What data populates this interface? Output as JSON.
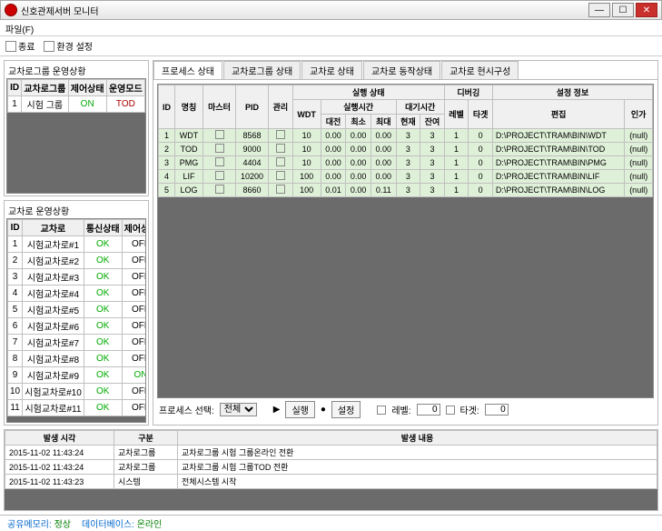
{
  "window": {
    "title": "신호관제서버 모니터"
  },
  "menu": {
    "file": "파일(F)"
  },
  "toolbar": {
    "exit": "종료",
    "env": "환경 설정"
  },
  "left": {
    "group1_title": "교차로그룹 운영상황",
    "g1_headers": [
      "ID",
      "교차로그룹",
      "제어상태",
      "운영모드"
    ],
    "g1_rows": [
      [
        "1",
        "시험 그룹",
        "ON",
        "TOD"
      ]
    ],
    "group2_title": "교차로 운영상황",
    "g2_headers": [
      "ID",
      "교차로",
      "통신상태",
      "제어상태"
    ],
    "g2_rows": [
      [
        "1",
        "시험교차로#1",
        "OK",
        "OFF"
      ],
      [
        "2",
        "시험교차로#2",
        "OK",
        "OFF"
      ],
      [
        "3",
        "시험교차로#3",
        "OK",
        "OFF"
      ],
      [
        "4",
        "시험교차로#4",
        "OK",
        "OFF"
      ],
      [
        "5",
        "시험교차로#5",
        "OK",
        "OFF"
      ],
      [
        "6",
        "시험교차로#6",
        "OK",
        "OFF"
      ],
      [
        "7",
        "시험교차로#7",
        "OK",
        "OFF"
      ],
      [
        "8",
        "시험교차로#8",
        "OK",
        "OFF"
      ],
      [
        "9",
        "시험교차로#9",
        "OK",
        "ON"
      ],
      [
        "10",
        "시험교차로#10",
        "OK",
        "OFF"
      ],
      [
        "11",
        "시험교차로#11",
        "OK",
        "OFF"
      ]
    ]
  },
  "tabs": {
    "t1": "프로세스 상태",
    "t2": "교차로그룹 상태",
    "t3": "교차로 상태",
    "t4": "교차로 동작상태",
    "t5": "교차로 현시구성"
  },
  "proc": {
    "group_top": [
      "실행 상태",
      "디버깅",
      "설정 정보"
    ],
    "group_mid": [
      "실행시간",
      "대기시간"
    ],
    "headers": [
      "ID",
      "명칭",
      "마스터",
      "PID",
      "관리",
      "WDT",
      "대전",
      "최소",
      "최대",
      "현재",
      "잔여",
      "레벨",
      "타겟",
      "편집",
      "인가"
    ],
    "rows": [
      {
        "id": "1",
        "name": "WDT",
        "pid": "8568",
        "wdt": "10",
        "a": "0.00",
        "b": "0.00",
        "c": "0.00",
        "d": "3",
        "e": "3",
        "lv": "1",
        "tg": "0",
        "path": "D:\\PROJECT\\TRAM\\BIN\\WDT",
        "auth": "(null)"
      },
      {
        "id": "2",
        "name": "TOD",
        "pid": "9000",
        "wdt": "10",
        "a": "0.00",
        "b": "0.00",
        "c": "0.00",
        "d": "3",
        "e": "3",
        "lv": "1",
        "tg": "0",
        "path": "D:\\PROJECT\\TRAM\\BIN\\TOD",
        "auth": "(null)"
      },
      {
        "id": "3",
        "name": "PMG",
        "pid": "4404",
        "wdt": "10",
        "a": "0.00",
        "b": "0.00",
        "c": "0.00",
        "d": "3",
        "e": "3",
        "lv": "1",
        "tg": "0",
        "path": "D:\\PROJECT\\TRAM\\BIN\\PMG",
        "auth": "(null)"
      },
      {
        "id": "4",
        "name": "LIF",
        "pid": "10200",
        "wdt": "100",
        "a": "0.00",
        "b": "0.00",
        "c": "0.00",
        "d": "3",
        "e": "3",
        "lv": "1",
        "tg": "0",
        "path": "D:\\PROJECT\\TRAM\\BIN\\LIF",
        "auth": "(null)"
      },
      {
        "id": "5",
        "name": "LOG",
        "pid": "8660",
        "wdt": "100",
        "a": "0.01",
        "b": "0.00",
        "c": "0.11",
        "d": "3",
        "e": "3",
        "lv": "1",
        "tg": "0",
        "path": "D:\\PROJECT\\TRAM\\BIN\\LOG",
        "auth": "(null)"
      }
    ]
  },
  "controls": {
    "select_label": "프로세스 선택:",
    "select_value": "전체",
    "play": "실행",
    "stop": "설정",
    "level_label": "레벨:",
    "level_value": "0",
    "target_label": "타겟:",
    "target_value": "0"
  },
  "logs": {
    "headers": [
      "발생 시각",
      "구분",
      "발생 내용"
    ],
    "rows": [
      [
        "2015-11-02 11:43:24",
        "교차로그룹",
        "교차로그룹 시험 그룹온라인 전환"
      ],
      [
        "2015-11-02 11:43:24",
        "교차로그룹",
        "교차로그룹 시험 그룹TOD 전환"
      ],
      [
        "2015-11-02 11:43:23",
        "시스템",
        "전체시스템 시작"
      ]
    ]
  },
  "status": {
    "mem_label": "공유메모리:",
    "mem_value": "정상",
    "db_label": "데이터베이스:",
    "db_value": "온라인"
  }
}
